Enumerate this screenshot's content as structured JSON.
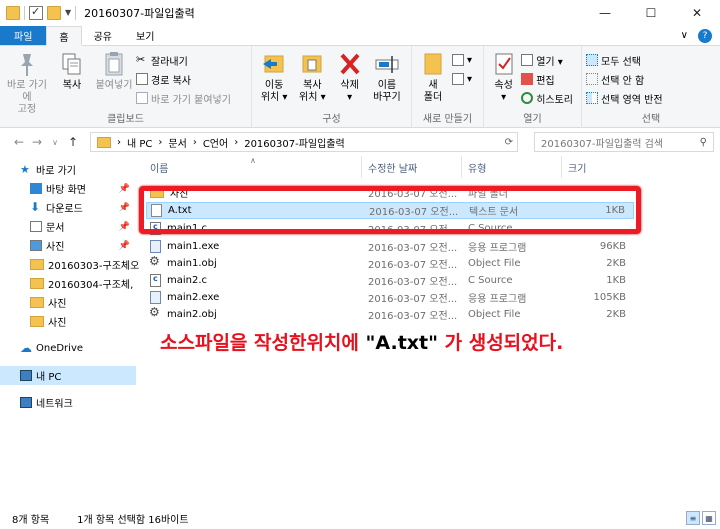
{
  "window": {
    "title": "20160307-파일입출력",
    "minimize": "—",
    "maximize": "☐",
    "close": "✕"
  },
  "tabs": {
    "file": "파일",
    "home": "홈",
    "share": "공유",
    "view": "보기",
    "collapse": "∨",
    "help": "?"
  },
  "ribbon": {
    "clipboard": {
      "label": "클립보드",
      "pin": "바로 가기에\n고정",
      "copy": "복사",
      "paste": "붙여넣기",
      "cut": "잘라내기",
      "copy_path": "경로 복사",
      "paste_shortcut": "바로 가기 붙여넣기"
    },
    "organize": {
      "label": "구성",
      "move_to": "이동\n위치 ▾",
      "copy_to": "복사\n위치 ▾",
      "delete": "삭제\n▾",
      "rename": "이름\n바꾸기"
    },
    "new": {
      "label": "새로 만들기",
      "new_folder": "새\n폴더"
    },
    "open": {
      "label": "열기",
      "properties": "속성\n▾",
      "open": "열기 ▾",
      "edit": "편집",
      "history": "히스토리"
    },
    "select": {
      "label": "선택",
      "select_all": "모두 선택",
      "select_none": "선택 안 함",
      "invert": "선택 영역 반전"
    }
  },
  "address": {
    "back": "←",
    "forward": "→",
    "up_recent": "∨",
    "up": "↑",
    "sep": "›",
    "crumbs": [
      "내 PC",
      "문서",
      "C언어",
      "20160307-파일입출력"
    ],
    "search_placeholder": "20160307-파일입출력 검색"
  },
  "nav": {
    "quick_access": "바로 가기",
    "items": [
      "바탕 화면",
      "다운로드",
      "문서",
      "사진",
      "20160303-구조체오",
      "20160304-구조체,",
      "사진",
      "사진"
    ],
    "onedrive": "OneDrive",
    "this_pc": "내 PC",
    "network": "네트워크"
  },
  "columns": {
    "name": "이름",
    "date": "수정한 날짜",
    "type": "유형",
    "size": "크기"
  },
  "files": [
    {
      "name": "사진",
      "date": "2016-03-07 오전...",
      "type": "파일 폴더",
      "size": "",
      "icon": "folder-icon"
    },
    {
      "name": "A.txt",
      "date": "2016-03-07 오전...",
      "type": "텍스트 문서",
      "size": "1KB",
      "icon": "text-file-icon"
    },
    {
      "name": "main1.c",
      "date": "2016-03-07 오전...",
      "type": "C Source",
      "size": "",
      "icon": "c-source-icon"
    },
    {
      "name": "main1.exe",
      "date": "2016-03-07 오전...",
      "type": "응용 프로그램",
      "size": "96KB",
      "icon": "exe-icon"
    },
    {
      "name": "main1.obj",
      "date": "2016-03-07 오전...",
      "type": "Object File",
      "size": "2KB",
      "icon": "obj-file-icon"
    },
    {
      "name": "main2.c",
      "date": "2016-03-07 오전...",
      "type": "C Source",
      "size": "1KB",
      "icon": "c-source-icon"
    },
    {
      "name": "main2.exe",
      "date": "2016-03-07 오전...",
      "type": "응용 프로그램",
      "size": "105KB",
      "icon": "exe-icon"
    },
    {
      "name": "main2.obj",
      "date": "2016-03-07 오전...",
      "type": "Object File",
      "size": "2KB",
      "icon": "obj-file-icon"
    }
  ],
  "caption": {
    "before": "소스파일을 작성한위치에 ",
    "quoted": "\"A.txt\"",
    "after": " 가 생성되었다."
  },
  "status": {
    "count": "8개 항목",
    "selected": "1개 항목 선택함 16바이트"
  },
  "colors": {
    "accent": "#1979ca",
    "highlight_border": "#ec1b24",
    "caption": "#e8101c",
    "selection": "#cce8ff"
  }
}
